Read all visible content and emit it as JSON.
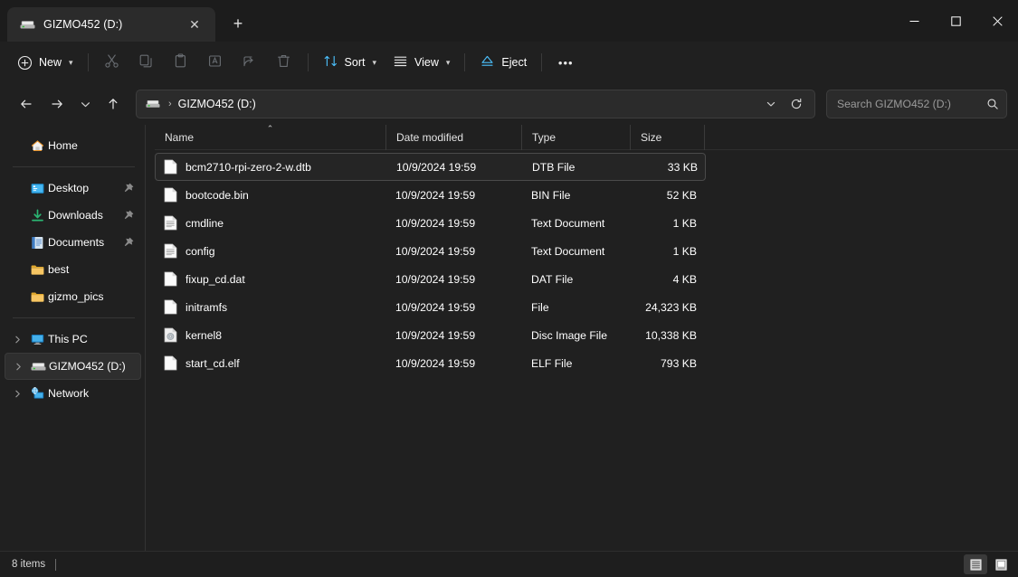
{
  "window": {
    "tab": {
      "title": "GIZMO452 (D:)",
      "icon": "drive-icon",
      "close_label": "✕"
    },
    "newtab_label": "+",
    "controls": {
      "minimize": "—",
      "maximize": "☐",
      "close": "✕"
    }
  },
  "toolbar": {
    "new_label": "New",
    "items": [
      {
        "name": "cut",
        "icon": "scissors-icon"
      },
      {
        "name": "copy",
        "icon": "copy-icon"
      },
      {
        "name": "paste",
        "icon": "paste-icon"
      },
      {
        "name": "rename",
        "icon": "rename-icon"
      },
      {
        "name": "share",
        "icon": "share-icon"
      },
      {
        "name": "delete",
        "icon": "trash-icon"
      }
    ],
    "sort_label": "Sort",
    "view_label": "View",
    "eject_label": "Eject",
    "overflow_label": "•••"
  },
  "address": {
    "back": "←",
    "forward": "→",
    "recent": "⌄",
    "up": "↑",
    "crumb_sep": "›",
    "crumb_text": "GIZMO452 (D:)",
    "dropdown": "⌄",
    "refresh": "↻"
  },
  "search": {
    "placeholder": "Search GIZMO452 (D:)",
    "value": "",
    "icon": "search-icon"
  },
  "sidebar": {
    "home": {
      "label": "Home",
      "icon": "home-icon"
    },
    "quick": [
      {
        "label": "Desktop",
        "icon": "desktop-icon",
        "pinned": true
      },
      {
        "label": "Downloads",
        "icon": "download-icon",
        "pinned": true
      },
      {
        "label": "Documents",
        "icon": "documents-icon",
        "pinned": true
      },
      {
        "label": "best",
        "icon": "folder-icon",
        "pinned": false
      },
      {
        "label": "gizmo_pics",
        "icon": "folder-icon",
        "pinned": false
      }
    ],
    "tree": [
      {
        "label": "This PC",
        "icon": "pc-icon",
        "selected": false
      },
      {
        "label": "GIZMO452 (D:)",
        "icon": "drive-icon",
        "selected": true
      },
      {
        "label": "Network",
        "icon": "network-icon",
        "selected": false
      }
    ]
  },
  "columns": {
    "name": "Name",
    "date_modified": "Date modified",
    "type": "Type",
    "size": "Size",
    "sort_indicator": "⌃"
  },
  "files": [
    {
      "name": "bcm2710-rpi-zero-2-w.dtb",
      "date": "10/9/2024 19:59",
      "type": "DTB File",
      "size": "33 KB",
      "icon": "blank-file-icon",
      "focused": true
    },
    {
      "name": "bootcode.bin",
      "date": "10/9/2024 19:59",
      "type": "BIN File",
      "size": "52 KB",
      "icon": "blank-file-icon",
      "focused": false
    },
    {
      "name": "cmdline",
      "date": "10/9/2024 19:59",
      "type": "Text Document",
      "size": "1 KB",
      "icon": "text-file-icon",
      "focused": false
    },
    {
      "name": "config",
      "date": "10/9/2024 19:59",
      "type": "Text Document",
      "size": "1 KB",
      "icon": "text-file-icon",
      "focused": false
    },
    {
      "name": "fixup_cd.dat",
      "date": "10/9/2024 19:59",
      "type": "DAT File",
      "size": "4 KB",
      "icon": "blank-file-icon",
      "focused": false
    },
    {
      "name": "initramfs",
      "date": "10/9/2024 19:59",
      "type": "File",
      "size": "24,323 KB",
      "icon": "blank-file-icon",
      "focused": false
    },
    {
      "name": "kernel8",
      "date": "10/9/2024 19:59",
      "type": "Disc Image File",
      "size": "10,338 KB",
      "icon": "disc-file-icon",
      "focused": false
    },
    {
      "name": "start_cd.elf",
      "date": "10/9/2024 19:59",
      "type": "ELF File",
      "size": "793 KB",
      "icon": "blank-file-icon",
      "focused": false
    }
  ],
  "status": {
    "items_text": "8 items",
    "details_view": "details-view-icon",
    "large_icons_view": "large-icons-view-icon"
  },
  "colors": {
    "accent": "#4cc2ff",
    "window_bg": "#202020",
    "titlebar_bg": "#1c1c1c",
    "tab_bg": "#2b2b2b",
    "selection": "#2e2e2e",
    "folder": "#f7c663"
  }
}
